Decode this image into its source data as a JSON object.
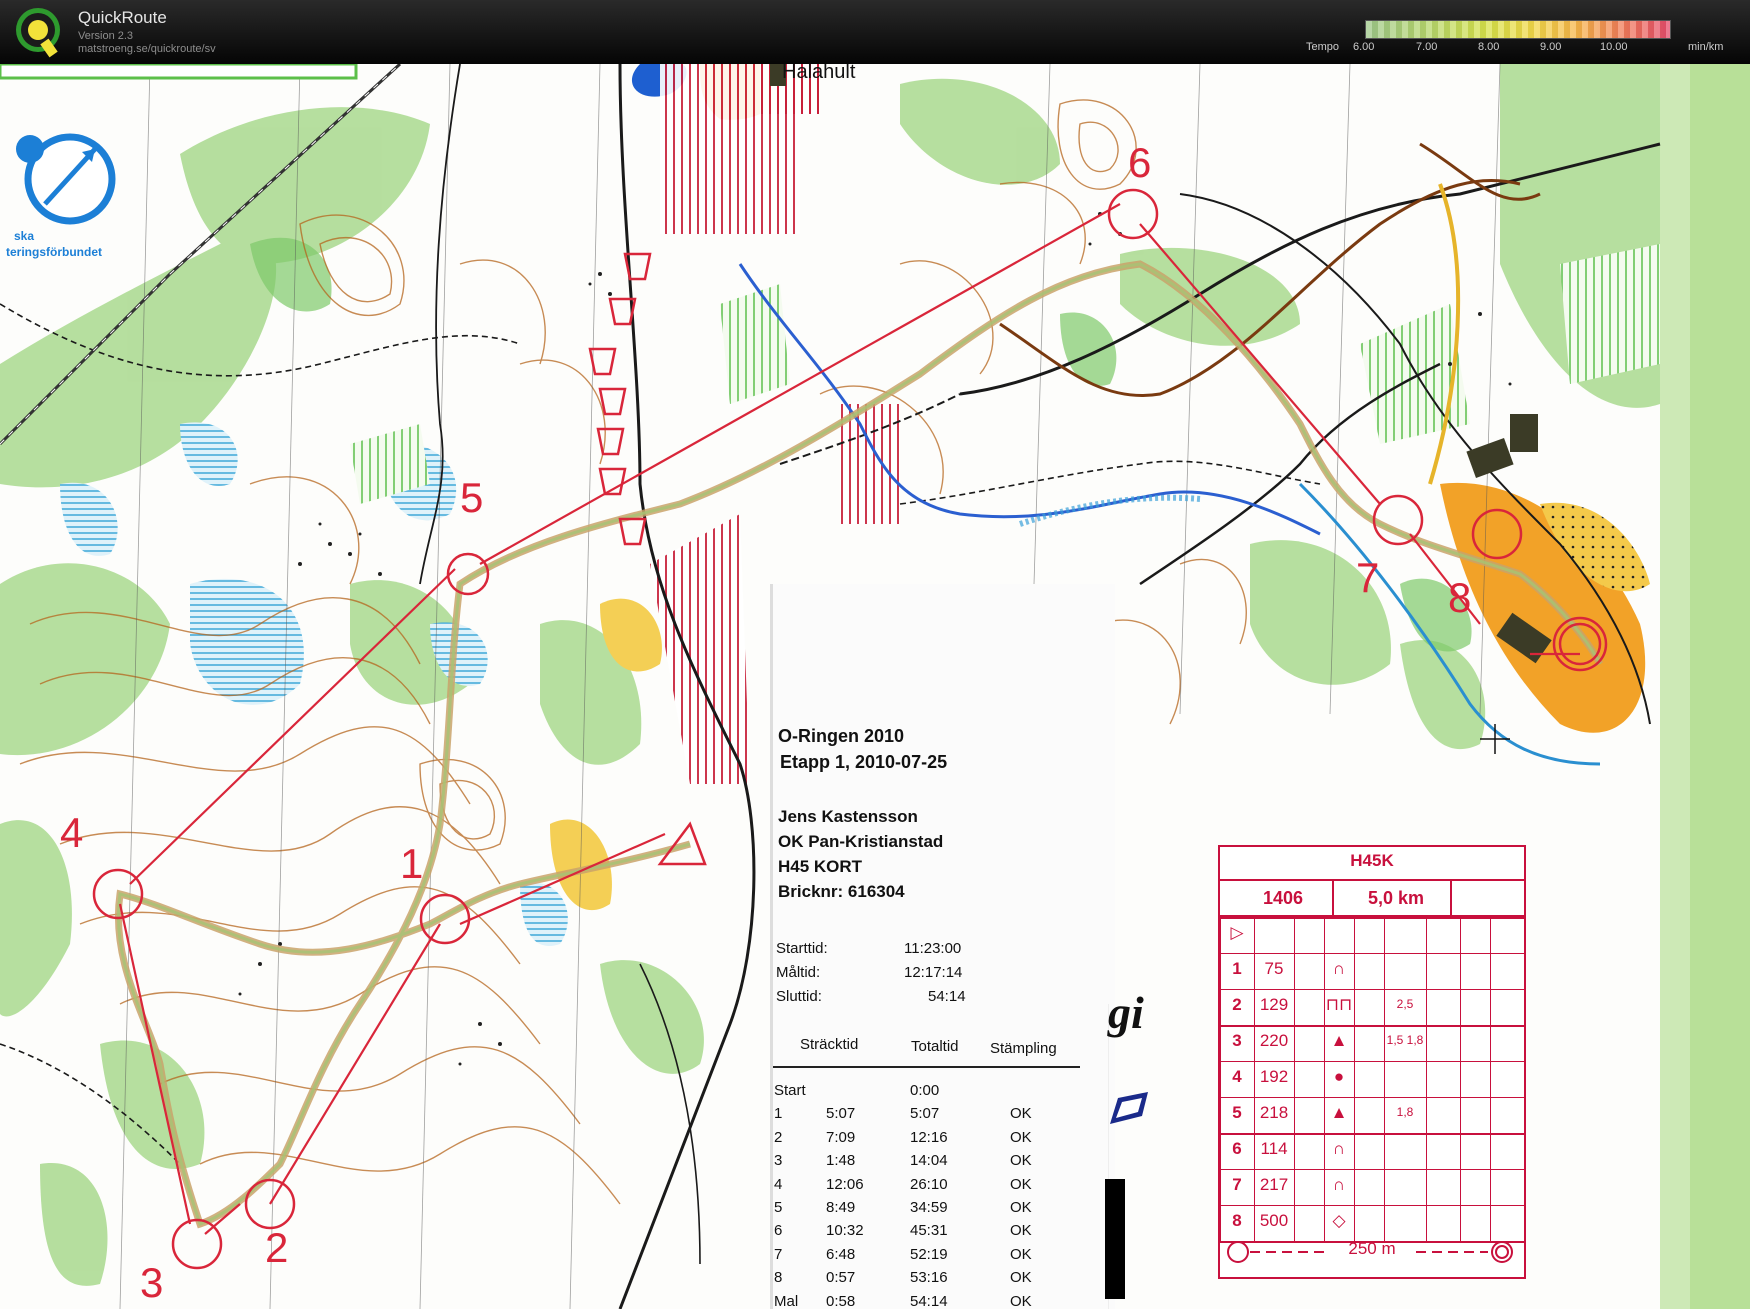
{
  "app": {
    "title": "QuickRoute",
    "version": "Version 2.3",
    "url": "matstroeng.se/quickroute/sv",
    "logo_letter": "Q"
  },
  "tempo": {
    "label": "Tempo",
    "ticks": [
      "6.00",
      "7.00",
      "8.00",
      "9.00",
      "10.00"
    ],
    "unit": "min/km"
  },
  "map": {
    "federation_text": [
      "ska",
      "teringsförbundet"
    ],
    "place_name": "Halahult",
    "control_numbers": [
      "1",
      "2",
      "3",
      "4",
      "5",
      "6",
      "7",
      "8"
    ]
  },
  "receipt": {
    "event": "O-Ringen 2010",
    "stage": "Etapp 1, 2010-07-25",
    "runner": "Jens Kastensson",
    "club": "OK Pan-Kristianstad",
    "class": "H45 KORT",
    "card": "Bricknr: 616304",
    "start_label": "Starttid:",
    "start_value": "11:23:00",
    "finish_label": "Måltid:",
    "finish_value": "12:17:14",
    "total_label": "Sluttid:",
    "total_value": "54:14",
    "columns": [
      "Sträcktid",
      "Totaltid",
      "Stämpling"
    ],
    "splits": [
      {
        "ctrl": "Start",
        "split": "",
        "total": "0:00",
        "status": ""
      },
      {
        "ctrl": "1",
        "split": "5:07",
        "total": "5:07",
        "status": "OK"
      },
      {
        "ctrl": "2",
        "split": "7:09",
        "total": "12:16",
        "status": "OK"
      },
      {
        "ctrl": "3",
        "split": "1:48",
        "total": "14:04",
        "status": "OK"
      },
      {
        "ctrl": "4",
        "split": "12:06",
        "total": "26:10",
        "status": "OK"
      },
      {
        "ctrl": "5",
        "split": "8:49",
        "total": "34:59",
        "status": "OK"
      },
      {
        "ctrl": "6",
        "split": "10:32",
        "total": "45:31",
        "status": "OK"
      },
      {
        "ctrl": "7",
        "split": "6:48",
        "total": "52:19",
        "status": "OK"
      },
      {
        "ctrl": "8",
        "split": "0:57",
        "total": "53:16",
        "status": "OK"
      },
      {
        "ctrl": "Mal",
        "split": "0:58",
        "total": "54:14",
        "status": "OK"
      }
    ],
    "side_logo_text": "gi"
  },
  "description": {
    "class": "H45K",
    "course_code": "1406",
    "length": "5,0 km",
    "rows": [
      {
        "num": "1",
        "code": "75",
        "dims": ""
      },
      {
        "num": "2",
        "code": "129",
        "dims": "2,5"
      },
      {
        "num": "3",
        "code": "220",
        "dims": "1,5 1,8"
      },
      {
        "num": "4",
        "code": "192",
        "dims": ""
      },
      {
        "num": "5",
        "code": "218",
        "dims": "1,8"
      },
      {
        "num": "6",
        "code": "114",
        "dims": ""
      },
      {
        "num": "7",
        "code": "217",
        "dims": ""
      },
      {
        "num": "8",
        "code": "500",
        "dims": ""
      }
    ],
    "finish_distance": "250 m"
  },
  "colors": {
    "course": "#d9263a",
    "route": "#c9a36a",
    "forest": "#a8d88a",
    "water": "#6cc0e8",
    "contour": "#b5651d"
  }
}
